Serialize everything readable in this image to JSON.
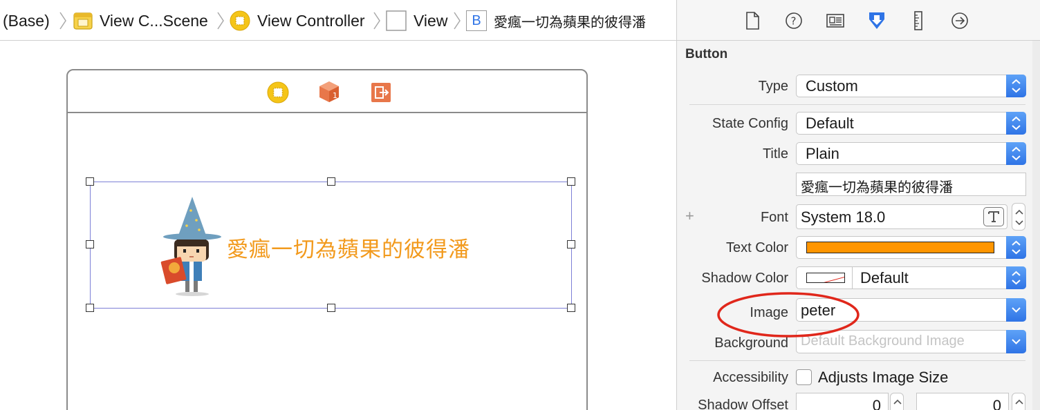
{
  "breadcrumb": [
    {
      "label": "(Base)",
      "icon": "none"
    },
    {
      "label": "View C...Scene",
      "icon": "storyboard-scene-icon"
    },
    {
      "label": "View Controller",
      "icon": "view-controller-icon"
    },
    {
      "label": "View",
      "icon": "view-icon"
    },
    {
      "label": "愛瘋一切為蘋果的彼得潘",
      "icon": "button-icon",
      "icon_glyph": "B"
    }
  ],
  "scene": {
    "dock_icons": [
      "view-controller-icon",
      "first-responder-icon",
      "exit-icon"
    ],
    "button_title": "愛瘋一切為蘋果的彼得潘",
    "button_image": "wizard-character-image",
    "title_color": "#f29a1d"
  },
  "inspector": {
    "tabs": [
      "file-inspector-icon",
      "quick-help-icon",
      "identity-inspector-icon",
      "attributes-inspector-icon",
      "size-inspector-icon",
      "connections-inspector-icon"
    ],
    "active_tab": "attributes-inspector-icon",
    "section_title": "Button",
    "type": {
      "label": "Type",
      "value": "Custom"
    },
    "state_config": {
      "label": "State Config",
      "value": "Default"
    },
    "title": {
      "label": "Title",
      "value": "Plain",
      "text": "愛瘋一切為蘋果的彼得潘"
    },
    "font": {
      "label": "Font",
      "value": "System 18.0",
      "plus": "+"
    },
    "text_color": {
      "label": "Text Color",
      "swatch": "#ff9500"
    },
    "shadow_color": {
      "label": "Shadow Color",
      "value": "Default"
    },
    "image": {
      "label": "Image",
      "value": "peter"
    },
    "background": {
      "label": "Background",
      "placeholder": "Default Background Image"
    },
    "accessibility": {
      "label": "Accessibility",
      "checkbox_label": "Adjusts Image Size",
      "checked": false
    },
    "shadow_offset": {
      "label": "Shadow Offset",
      "width": "0",
      "height": "0"
    }
  },
  "colors": {
    "accent_blue": "#2f74e6",
    "annotation_red": "#e0271b",
    "selection_outline": "#7c7fd6"
  }
}
